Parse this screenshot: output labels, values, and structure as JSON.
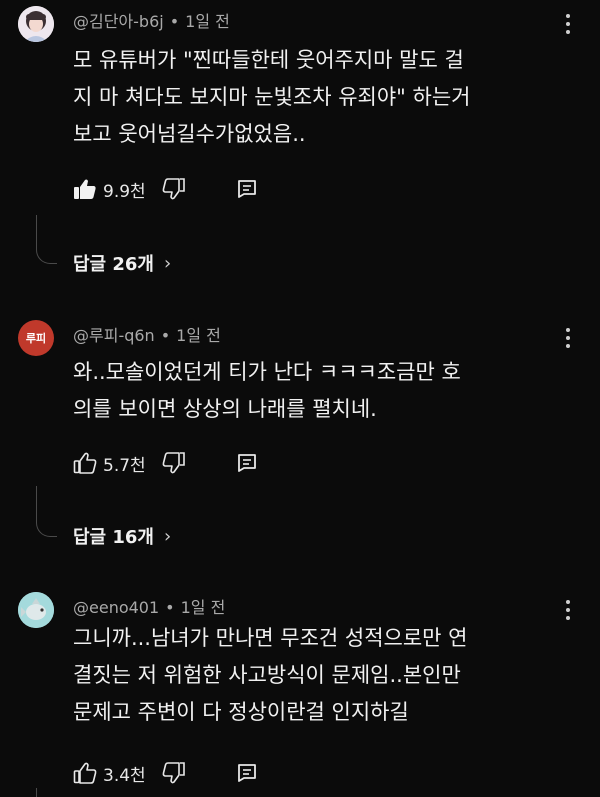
{
  "comments": [
    {
      "author": "@김단아-b6j",
      "time": "1일 전",
      "text": "모 유튜버가 \"찐따들한테 웃어주지마 말도 걸\n지 마 쳐다도 보지마 눈빛조차 유죄야\" 하는거\n보고 웃어넘길수가없었음..",
      "likes": "9.9천",
      "liked": true,
      "replies_label": "답글 26개"
    },
    {
      "author": "@루피-q6n",
      "avatar_text": "루피",
      "time": "1일 전",
      "text": "와..모솔이었던게 티가 난다 ㅋㅋㅋ조금만 호\n의를 보이면 상상의 나래를 펼치네.",
      "likes": "5.7천",
      "liked": false,
      "replies_label": "답글 16개"
    },
    {
      "author": "@eeno401",
      "time": "1일 전",
      "text": "그니까...남녀가 만나면 무조건 성적으로만 연\n결짓는 저 위험한 사고방식이 문제임..본인만\n문제고 주변이 다 정상이란걸 인지하길",
      "likes": "3.4천",
      "liked": false
    }
  ],
  "separator": "•",
  "chevron": "›",
  "colors": {
    "background": "#0b0b0b",
    "avatar_red": "#c0392b",
    "avatar_teal": "#8fd3d6"
  },
  "icons": [
    "thumbs-up-icon",
    "thumbs-down-icon",
    "reply-icon",
    "more-vert-icon"
  ]
}
